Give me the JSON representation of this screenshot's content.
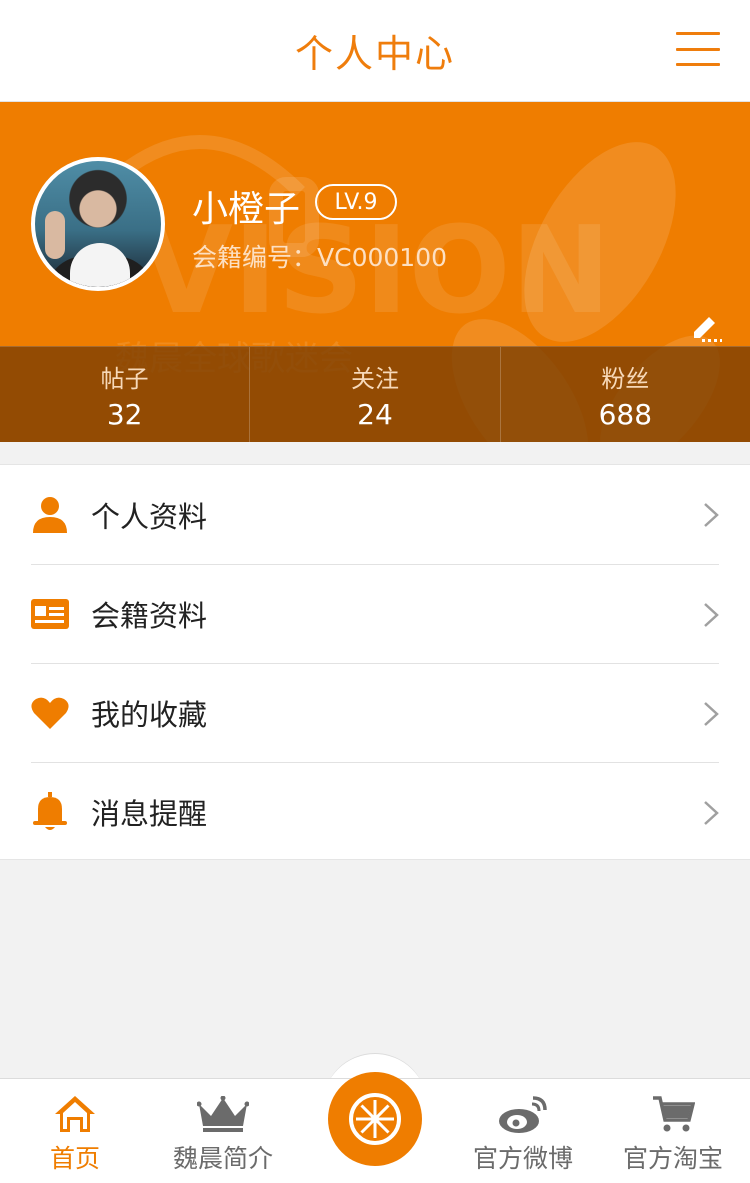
{
  "header": {
    "title": "个人中心",
    "menu_icon": "hamburger-menu-icon"
  },
  "profile": {
    "username": "小橙子",
    "level": "LV.9",
    "member_label": "会籍编号：",
    "member_id": "VC000100",
    "watermark_text": "魏晨全球歌迷会",
    "avatar_icon": "avatar",
    "edit_icon": "edit-pencil-icon"
  },
  "stats": [
    {
      "label": "帖子",
      "value": "32"
    },
    {
      "label": "关注",
      "value": "24"
    },
    {
      "label": "粉丝",
      "value": "688"
    }
  ],
  "menu": [
    {
      "label": "个人资料",
      "icon": "user-icon"
    },
    {
      "label": "会籍资料",
      "icon": "id-card-icon"
    },
    {
      "label": "我的收藏",
      "icon": "heart-icon"
    },
    {
      "label": "消息提醒",
      "icon": "bell-icon"
    }
  ],
  "tabbar": [
    {
      "label": "首页",
      "icon": "home-icon",
      "active": true
    },
    {
      "label": "魏晨简介",
      "icon": "crown-icon",
      "active": false
    },
    {
      "label": "",
      "icon": "orange-slice-icon",
      "active": false
    },
    {
      "label": "官方微博",
      "icon": "weibo-icon",
      "active": false
    },
    {
      "label": "官方淘宝",
      "icon": "cart-icon",
      "active": false
    }
  ],
  "colors": {
    "accent": "#ef7d00",
    "header_text": "#ef7d0c",
    "background": "#f2f2f2",
    "stats_bar": "#7a3e04",
    "tab_inactive": "#6b6b6b"
  }
}
